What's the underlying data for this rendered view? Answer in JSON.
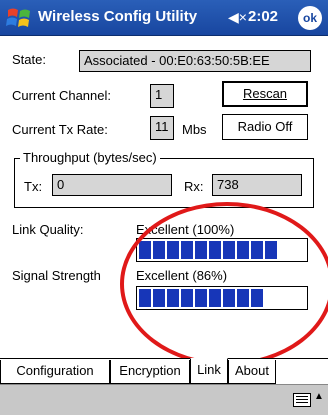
{
  "window": {
    "title": "Wireless Config Utility",
    "time": "2:02",
    "ok_label": "ok",
    "volume_glyph": "◀×"
  },
  "state": {
    "label": "State:",
    "value": "Associated - 00:E0:63:50:5B:EE"
  },
  "channel": {
    "label": "Current Channel:",
    "value": "1"
  },
  "tx_rate": {
    "label": "Current Tx Rate:",
    "value": "11",
    "unit": "Mbs"
  },
  "buttons": {
    "rescan": "Rescan",
    "radio_off": "Radio Off"
  },
  "throughput": {
    "title": "Throughput (bytes/sec)",
    "tx_label": "Tx:",
    "tx_value": "0",
    "rx_label": "Rx:",
    "rx_value": "738"
  },
  "link_quality": {
    "label": "Link Quality:",
    "text": "Excellent (100%)",
    "blocks": 10,
    "max_blocks": 10
  },
  "signal_strength": {
    "label": "Signal Strength",
    "text": "Excellent (86%)",
    "blocks": 9,
    "max_blocks": 10
  },
  "tabs": [
    {
      "label": "Configuration",
      "active": false
    },
    {
      "label": "Encryption",
      "active": false
    },
    {
      "label": "Link",
      "active": true
    },
    {
      "label": "About",
      "active": false
    }
  ],
  "colors": {
    "titlebar": "#1846a0",
    "meter_block": "#1736b8",
    "annotation_ellipse": "#e01919"
  }
}
